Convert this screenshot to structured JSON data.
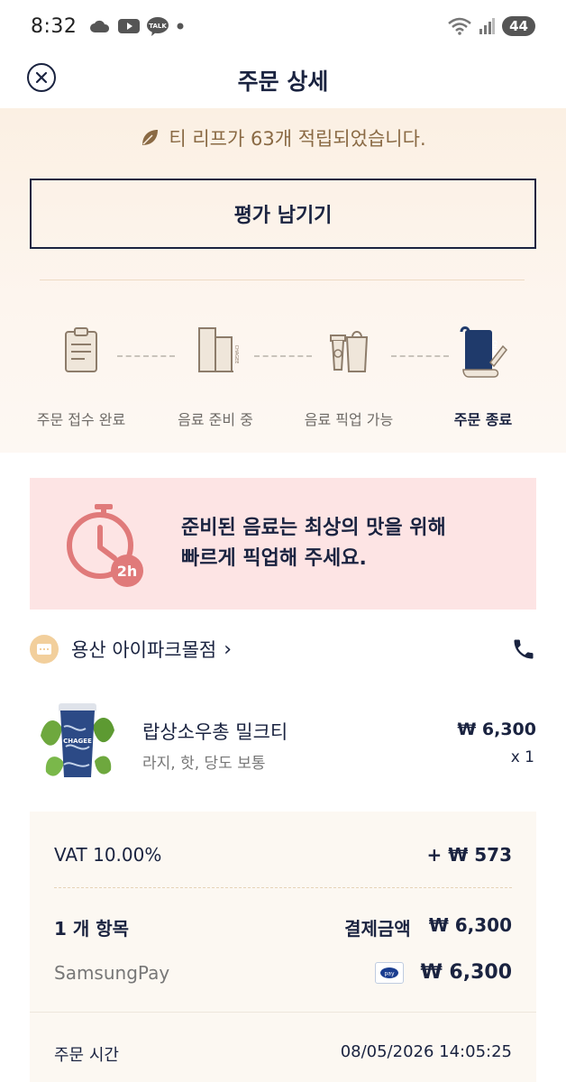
{
  "status_bar": {
    "time": "8:32",
    "battery": "44",
    "icons": [
      "cloud-icon",
      "youtube-icon",
      "talk-icon",
      "dot-icon",
      "wifi-icon",
      "signal-icon",
      "battery-icon"
    ]
  },
  "header": {
    "title": "주문 상세"
  },
  "reward": {
    "message": "티 리프가 63개 적립되었습니다."
  },
  "review_button": {
    "label": "평가 남기기"
  },
  "steps": [
    {
      "label": "주문 접수 완료",
      "active": false
    },
    {
      "label": "음료 준비 중",
      "active": false
    },
    {
      "label": "음료 픽업 가능",
      "active": false
    },
    {
      "label": "주문 종료",
      "active": true
    }
  ],
  "notice": {
    "badge": "2h",
    "line1": "준비된 음료는 최상의 맛을 위해",
    "line2": "빠르게 픽업해 주세요."
  },
  "store": {
    "name": "용산 아이파크몰점",
    "chevron": "›"
  },
  "product": {
    "name": "랍상소우총 밀크티",
    "options": "라지,  핫, 당도 보통",
    "price": "₩ 6,300",
    "quantity": "x 1",
    "cup_brand": "CHAGEE"
  },
  "summary": {
    "vat_label": "VAT 10.00%",
    "vat_amount": "+ ₩ 573",
    "items_count": "1 개 항목",
    "payment_label": "결제금액",
    "payment_total": "₩ 6,300",
    "payment_method": "SamsungPay",
    "pay_badge": "pay",
    "payment_amount": "₩ 6,300",
    "order_time_label": "주문 시간",
    "order_time": "08/05/2026 14:05:25"
  },
  "colors": {
    "navy": "#1a2340",
    "warm_bg": "#fbf0e3",
    "notice_bg": "#fde4e4",
    "timer": "#e07a7a",
    "leaf": "#8a6a44"
  }
}
